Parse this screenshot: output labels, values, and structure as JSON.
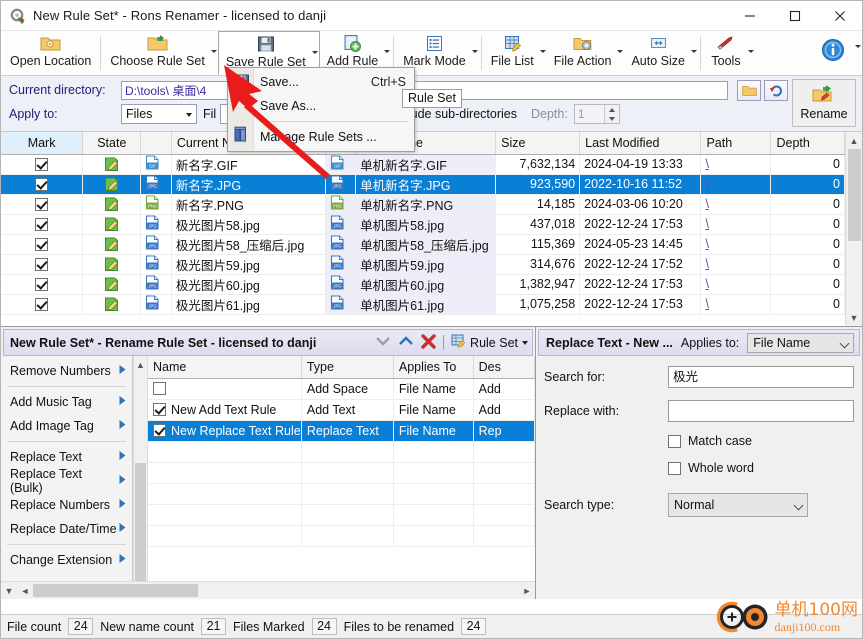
{
  "window": {
    "title": "New Rule Set* - Rons Renamer - licensed to danji",
    "app_icon": "app-gear-icon",
    "minimize": "–",
    "maximize": "□",
    "close": "✕"
  },
  "toolbar": {
    "items": [
      {
        "label": "Open Location",
        "icon": "open-folder-icon",
        "caret": false
      },
      {
        "label": "Choose Rule Set",
        "icon": "choose-folder-icon",
        "caret": true
      },
      {
        "label": "Save Rule Set",
        "icon": "floppy-disk-icon",
        "caret": true,
        "active": true
      },
      {
        "label": "Add Rule",
        "icon": "add-rule-icon",
        "caret": true
      },
      {
        "label": "Mark Mode",
        "icon": "list-icon",
        "caret": true
      },
      {
        "label": "File List",
        "icon": "file-list-icon",
        "caret": true
      },
      {
        "label": "File Action",
        "icon": "file-action-icon",
        "caret": true
      },
      {
        "label": "Auto Size",
        "icon": "auto-size-icon",
        "caret": true
      },
      {
        "label": "Tools",
        "icon": "wrench-icon",
        "caret": true
      },
      {
        "label": "",
        "icon": "info-icon",
        "caret": true
      }
    ]
  },
  "save_menu": {
    "items": [
      {
        "label": "Save...",
        "shortcut": "Ctrl+S",
        "icon": "floppy-disk-icon"
      },
      {
        "label": "Save As...",
        "shortcut": "",
        "icon": ""
      },
      {
        "label": "Manage Rule Sets ...",
        "shortcut": "",
        "icon": "books-icon"
      }
    ]
  },
  "pathbar": {
    "current_directory_label": "Current directory:",
    "current_directory_value": "D:\\tools\\ 桌面\\4",
    "apply_to_label": "Apply to:",
    "apply_to_value": "Files",
    "filter_label": "Fil",
    "include_subdirs_label": "Include sub-directories",
    "include_subdirs_checked": false,
    "depth_label": "Depth:",
    "depth_value": "1",
    "open_folder_button": "open-folder-icon",
    "refresh_button": "refresh-icon",
    "rename_button_label": "Rename",
    "tooltip": "Rule Set"
  },
  "file_table": {
    "columns": [
      "Mark",
      "State",
      "",
      "Current Name",
      "",
      "New Name",
      "Size",
      "Last Modified",
      "Path",
      "Depth"
    ],
    "rows": [
      {
        "marked": true,
        "state": "edit-icon",
        "type": "GIF",
        "current": "新名字.GIF",
        "new": "单机新名字.GIF",
        "size": "7,632,134",
        "modified": "2024-04-19 13:33",
        "path": "\\",
        "depth": "0",
        "selected": false
      },
      {
        "marked": true,
        "state": "edit-icon",
        "type": "JPG",
        "current": "新名字.JPG",
        "new": "单机新名字.JPG",
        "size": "923,590",
        "modified": "2022-10-16 11:52",
        "path": "\\",
        "depth": "0",
        "selected": true
      },
      {
        "marked": true,
        "state": "edit-icon",
        "type": "PNG",
        "current": "新名字.PNG",
        "new": "单机新名字.PNG",
        "size": "14,185",
        "modified": "2024-03-06 10:20",
        "path": "\\",
        "depth": "0",
        "selected": false
      },
      {
        "marked": true,
        "state": "edit-icon",
        "type": "JPG",
        "current": "极光图片58.jpg",
        "new": "单机图片58.jpg",
        "size": "437,018",
        "modified": "2022-12-24 17:53",
        "path": "\\",
        "depth": "0",
        "selected": false
      },
      {
        "marked": true,
        "state": "edit-icon",
        "type": "JPG",
        "current": "极光图片58_压缩后.jpg",
        "new": "单机图片58_压缩后.jpg",
        "size": "115,369",
        "modified": "2024-05-23 14:45",
        "path": "\\",
        "depth": "0",
        "selected": false
      },
      {
        "marked": true,
        "state": "edit-icon",
        "type": "JPG",
        "current": "极光图片59.jpg",
        "new": "单机图片59.jpg",
        "size": "314,676",
        "modified": "2022-12-24 17:52",
        "path": "\\",
        "depth": "0",
        "selected": false
      },
      {
        "marked": true,
        "state": "edit-icon",
        "type": "JPG",
        "current": "极光图片60.jpg",
        "new": "单机图片60.jpg",
        "size": "1,382,947",
        "modified": "2022-12-24 17:53",
        "path": "\\",
        "depth": "0",
        "selected": false
      },
      {
        "marked": true,
        "state": "edit-icon",
        "type": "JPG",
        "current": "极光图片61.jpg",
        "new": "单机图片61.jpg",
        "size": "1,075,258",
        "modified": "2022-12-24 17:53",
        "path": "\\",
        "depth": "0",
        "selected": false
      }
    ]
  },
  "rule_panel": {
    "header_title": "New Rule Set* - Rename Rule Set - licensed to danji",
    "move_down_icon": "chevron-down-icon",
    "move_up_icon": "chevron-up-icon",
    "delete_icon": "red-x-icon",
    "ruleset_label": "Rule Set",
    "ruleset_icon": "ruleset-icon"
  },
  "side_menu": {
    "groups": [
      {
        "items": [
          {
            "label": "Remove Numbers",
            "arrow": "►"
          }
        ]
      },
      {
        "items": [
          {
            "label": "Add Music Tag",
            "arrow": "►"
          },
          {
            "label": "Add Image Tag",
            "arrow": "►"
          }
        ]
      },
      {
        "items": [
          {
            "label": "Replace Text",
            "arrow": "►"
          },
          {
            "label": "Replace Text (Bulk)",
            "arrow": "►"
          },
          {
            "label": "Replace Numbers",
            "arrow": "►"
          },
          {
            "label": "Replace Date/Time",
            "arrow": "►"
          }
        ]
      },
      {
        "items": [
          {
            "label": "Change Extension",
            "arrow": "►"
          }
        ]
      }
    ]
  },
  "rules_table": {
    "columns": [
      "Name",
      "Type",
      "Applies To",
      "Des"
    ],
    "rows": [
      {
        "checked": false,
        "name": "",
        "type": "Add Space",
        "applies": "File Name",
        "desc": "Add",
        "selected": false
      },
      {
        "checked": true,
        "name": "New Add Text Rule",
        "type": "Add Text",
        "applies": "File Name",
        "desc": "Add",
        "selected": false
      },
      {
        "checked": true,
        "name": "New Replace Text Rule",
        "type": "Replace Text",
        "applies": "File Name",
        "desc": "Rep",
        "selected": true
      }
    ]
  },
  "properties": {
    "title": "Replace Text - New ...",
    "applies_to_label": "Applies to:",
    "applies_to_value": "File Name",
    "search_for_label": "Search for:",
    "search_for_value": "极光",
    "replace_with_label": "Replace with:",
    "replace_with_value": "",
    "match_case_label": "Match case",
    "match_case_checked": false,
    "whole_word_label": "Whole word",
    "whole_word_checked": false,
    "search_type_label": "Search type:",
    "search_type_value": "Normal"
  },
  "status_bar": {
    "file_count_label": "File count",
    "file_count_value": "24",
    "new_name_count_label": "New name count",
    "new_name_count_value": "21",
    "files_marked_label": "Files Marked",
    "files_marked_value": "24",
    "files_to_rename_label": "Files to be renamed",
    "files_to_rename_value": "24"
  },
  "watermark": {
    "line1": "单机100网",
    "line2": "danji100.com"
  },
  "colors": {
    "selection_blue": "#0a7fd6",
    "panel_header": "#e4e4f2",
    "accent_orange": "#f08326",
    "path_link": "#7a3fa0",
    "path_text": "#3b2ba0"
  }
}
